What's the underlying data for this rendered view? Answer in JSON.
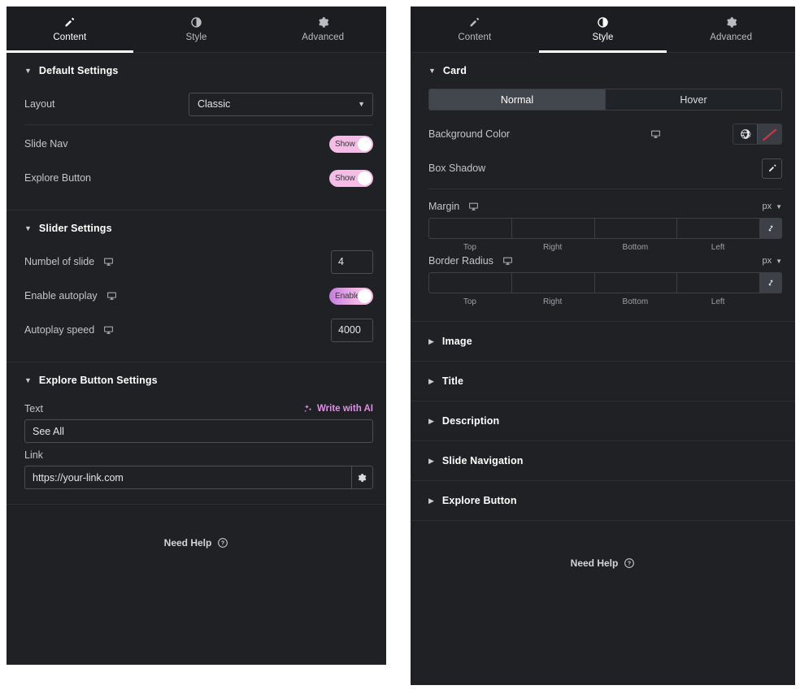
{
  "tabs": [
    {
      "id": "content",
      "label": "Content",
      "icon": "pencil-icon"
    },
    {
      "id": "style",
      "label": "Style",
      "icon": "contrast-icon"
    },
    {
      "id": "advanced",
      "label": "Advanced",
      "icon": "gear-icon"
    }
  ],
  "left_panel": {
    "active_tab": "Content",
    "sections": {
      "default_settings": {
        "title": "Default Settings",
        "layout": {
          "label": "Layout",
          "value": "Classic"
        },
        "slide_nav": {
          "label": "Slide Nav",
          "state": "Show"
        },
        "explore_button": {
          "label": "Explore Button",
          "state": "Show"
        }
      },
      "slider_settings": {
        "title": "Slider Settings",
        "number_of_slide": {
          "label": "Numbel of slide",
          "value": "4"
        },
        "enable_autoplay": {
          "label": "Enable autoplay",
          "state": "Enable"
        },
        "autoplay_speed": {
          "label": "Autoplay speed",
          "value": "4000"
        }
      },
      "explore_button_settings": {
        "title": "Explore Button Settings",
        "text": {
          "label": "Text",
          "value": "See All",
          "ai_label": "Write with AI"
        },
        "link": {
          "label": "Link",
          "value": "https://your-link.com"
        }
      }
    },
    "need_help": "Need Help"
  },
  "right_panel": {
    "active_tab": "Style",
    "card": {
      "title": "Card",
      "states": [
        {
          "label": "Normal",
          "active": true
        },
        {
          "label": "Hover",
          "active": false
        }
      ],
      "background_color": {
        "label": "Background Color"
      },
      "box_shadow": {
        "label": "Box Shadow"
      },
      "margin": {
        "label": "Margin",
        "unit": "px",
        "values": [
          "",
          "",
          "",
          ""
        ],
        "captions": [
          "Top",
          "Right",
          "Bottom",
          "Left"
        ]
      },
      "border_radius": {
        "label": "Border Radius",
        "unit": "px",
        "values": [
          "",
          "",
          "",
          ""
        ],
        "captions": [
          "Top",
          "Right",
          "Bottom",
          "Left"
        ]
      }
    },
    "collapsed_sections": [
      {
        "title": "Image"
      },
      {
        "title": "Title"
      },
      {
        "title": "Description"
      },
      {
        "title": "Slide Navigation"
      },
      {
        "title": "Explore Button"
      }
    ],
    "need_help": "Need Help"
  },
  "colors": {
    "panel_bg": "#1f2124",
    "tabbar_bg": "#1b1d20",
    "accent_pink": "#f3bde5",
    "accent_purple": "#c77ce0",
    "ai_text": "#e08fe6",
    "active_segment": "#42464d",
    "swatch_slash": "#d6334b",
    "divider": "#2b2e33"
  }
}
